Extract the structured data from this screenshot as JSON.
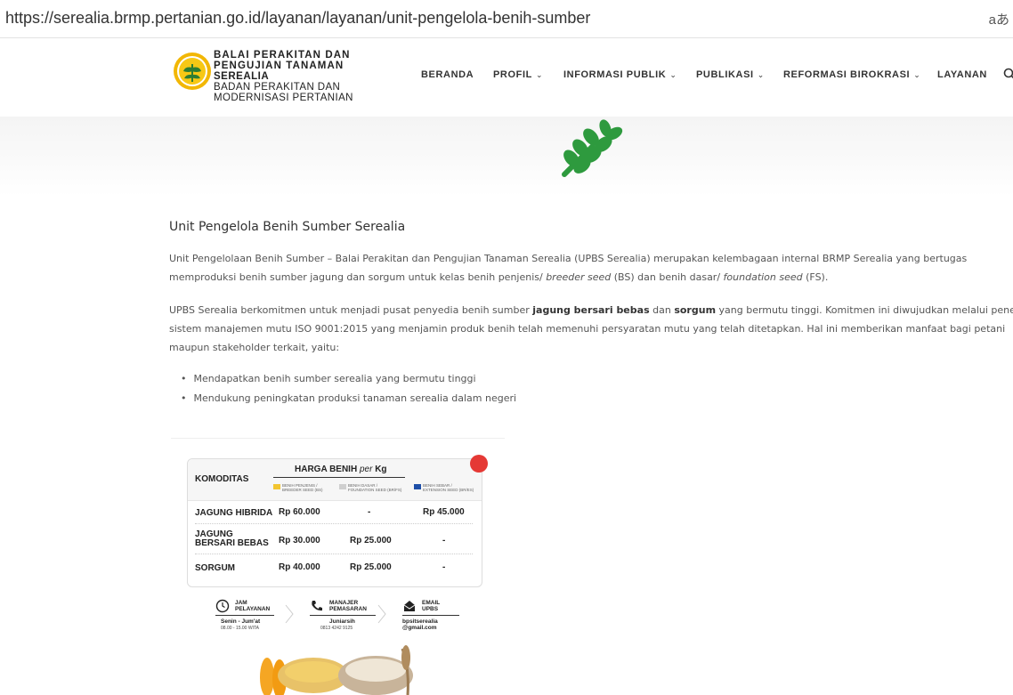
{
  "browser": {
    "url": "https://serealia.brmp.pertanian.go.id/layanan/layanan/unit-pengelola-benih-sumber",
    "ime_indicator": "aあ"
  },
  "header": {
    "org_lines": [
      "BALAI PERAKITAN DAN",
      "PENGUJIAN TANAMAN",
      "SEREALIA",
      "BADAN PERAKITAN DAN",
      "MODERNISASI PERTANIAN"
    ],
    "menu": [
      {
        "label": "BERANDA",
        "dropdown": false
      },
      {
        "label": "PROFIL",
        "dropdown": true
      },
      {
        "label": "INFORMASI PUBLIK",
        "dropdown": true
      },
      {
        "label": "PUBLIKASI",
        "dropdown": true
      },
      {
        "label": "REFORMASI BIROKRASI",
        "dropdown": true
      },
      {
        "label": "LAYANAN",
        "dropdown": false
      }
    ],
    "icons": {
      "logo": "ministry-logo",
      "search": "search-icon"
    }
  },
  "hero": {
    "icon": "wheat-icon",
    "color": "#2e9a3e"
  },
  "content": {
    "title": "Unit Pengelola Benih Sumber Serealia",
    "p1": {
      "line1": "Unit Pengelolaan Benih Sumber – Balai Perakitan dan Pengujian Tanaman Serealia (UPBS Serealia) merupakan kelembagaan internal BRMP Serealia yang bertugas",
      "line2a": "memproduksi benih sumber jagung dan sorgum untuk kelas benih penjenis/ ",
      "line2b": "breeder seed",
      "line2c": " (BS) dan benih dasar/ ",
      "line2d": "foundation seed",
      "line2e": " (FS)."
    },
    "p2": {
      "line1a": "UPBS Serealia berkomitmen untuk menjadi pusat penyedia benih sumber ",
      "line1b": "jagung bersari bebas",
      "line1c": " dan ",
      "line1d": "sorgum",
      "line1e": " yang bermutu tinggi. Komitmen ini diwujudkan melalui penerapan",
      "line2": "sistem manajemen mutu ISO 9001:2015 yang menjamin produk benih telah memenuhi persyaratan mutu yang telah ditetapkan. Hal ini memberikan manfaat bagi petani",
      "line3": "maupun stakeholder terkait, yaitu:"
    },
    "bullets": [
      "Mendapatkan benih sumber serealia yang bermutu tinggi",
      "Mendukung peningkatan produksi tanaman serealia dalam negeri"
    ]
  },
  "poster": {
    "komoditas_header": "KOMODITAS",
    "harga_prefix": "HARGA BENIH ",
    "harga_per": "per",
    "harga_unit": " Kg",
    "columns": [
      {
        "line1": "BENIH PENJENIS /",
        "line2": "BREEDER SEED (BS)",
        "color": "#f2c531"
      },
      {
        "line1": "BENIH DASAR /",
        "line2": "FOUNDATION SEED (BR/FS)",
        "color": "#cfcfcf"
      },
      {
        "line1": "BENIH SEBAR /",
        "line2": "EXTENSION SEED (BR/ES)",
        "color": "#1e4fa8"
      }
    ],
    "rows": [
      {
        "name": "JAGUNG HIBRIDA",
        "bs": "Rp 60.000",
        "fs": "-",
        "es": "Rp 45.000"
      },
      {
        "name1": "JAGUNG",
        "name2": "BERSARI BEBAS",
        "bs": "Rp 30.000",
        "fs": "Rp 25.000",
        "es": "-"
      },
      {
        "name": "SORGUM",
        "bs": "Rp 40.000",
        "fs": "Rp 25.000",
        "es": "-"
      }
    ],
    "info": [
      {
        "label1": "JAM",
        "label2": "PELAYANAN",
        "value1": "Senin - Jum'at",
        "value2": "08.00 - 15.00 WITA",
        "icon": "clock-icon"
      },
      {
        "label1": "MANAJER",
        "label2": "PEMASARAN",
        "value1": "Juniarsih",
        "value2": "0813 4242 9125",
        "icon": "phone-icon"
      },
      {
        "label1": "EMAIL",
        "label2": "UPBS",
        "value1": "bpsitserealia",
        "value2": "@gmail.com",
        "icon": "email-icon"
      }
    ]
  }
}
